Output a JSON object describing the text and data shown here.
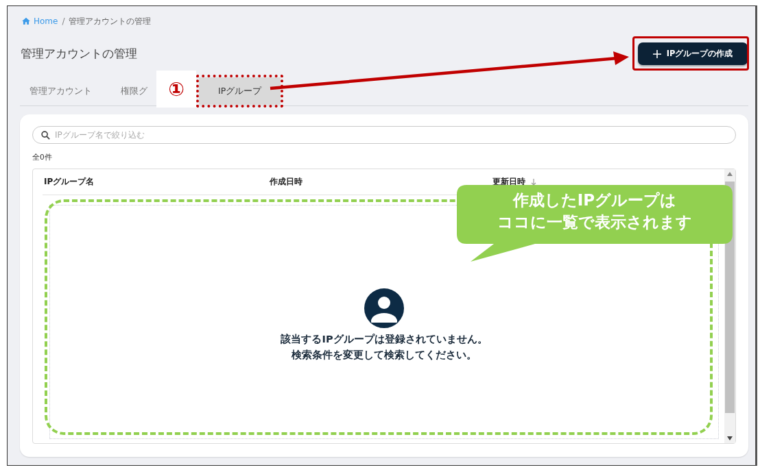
{
  "breadcrumb": [
    {
      "label": "Home",
      "kind": "link"
    },
    {
      "label": "管理アカウントの管理",
      "kind": "current"
    }
  ],
  "breadcrumb_separator": "/",
  "page_title": "管理アカウントの管理",
  "create_button": {
    "label": "IPグループの作成"
  },
  "tabs": [
    {
      "label": "管理アカウント",
      "selected": false
    },
    {
      "label": "権限グ",
      "selected": false
    },
    {
      "label": "IPグループ",
      "selected": true
    }
  ],
  "search": {
    "placeholder": "IPグループ名で絞り込む"
  },
  "result_count": "全0件",
  "table": {
    "columns": [
      {
        "label": "IPグループ名",
        "sorted": false
      },
      {
        "label": "作成日時",
        "sorted": false
      },
      {
        "label": "更新日時",
        "sorted": true
      }
    ]
  },
  "empty_state": {
    "lines": [
      "該当するIPグループは登録されていません。",
      "検索条件を変更して検索してください。"
    ]
  },
  "annotations": {
    "step_marker": "①",
    "callout_lines": [
      "作成したIPグループは",
      "ココに一覧で表示されます"
    ]
  }
}
